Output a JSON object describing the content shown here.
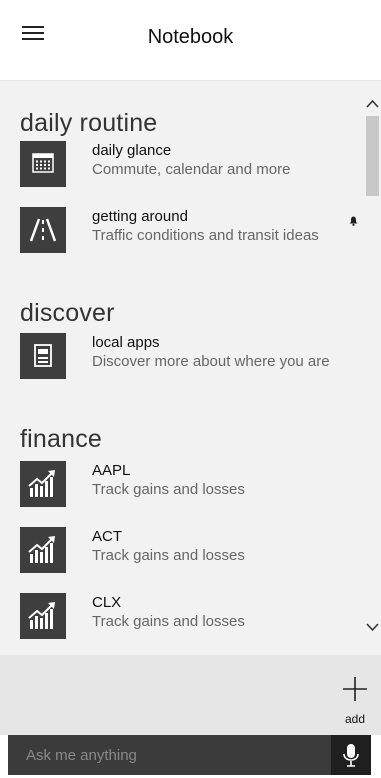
{
  "header": {
    "title": "Notebook",
    "menu_icon": "hamburger-icon"
  },
  "sections": [
    {
      "title": "daily routine",
      "items": [
        {
          "title": "daily glance",
          "subtitle": "Commute, calendar and more",
          "icon": "calendar-icon"
        },
        {
          "title": "getting around",
          "subtitle": "Traffic conditions and transit ideas",
          "icon": "road-icon",
          "badge": "bell-icon"
        }
      ]
    },
    {
      "title": "discover",
      "items": [
        {
          "title": "local apps",
          "subtitle": "Discover more about where you are",
          "icon": "apps-icon"
        }
      ]
    },
    {
      "title": "finance",
      "items": [
        {
          "title": "AAPL",
          "subtitle": "Track gains and losses",
          "icon": "stock-chart-icon"
        },
        {
          "title": "ACT",
          "subtitle": "Track gains and losses",
          "icon": "stock-chart-icon"
        },
        {
          "title": "CLX",
          "subtitle": "Track gains and losses",
          "icon": "stock-chart-icon"
        }
      ]
    }
  ],
  "actions": {
    "add_label": "add",
    "add_icon": "plus-icon"
  },
  "search": {
    "placeholder": "Ask me anything",
    "mic_icon": "microphone-icon"
  },
  "colors": {
    "tile": "#3e3e3e",
    "content_bg": "#f2f2f2",
    "bottom_bg": "#e6e6e6",
    "search_bg": "#3b3b3b"
  }
}
